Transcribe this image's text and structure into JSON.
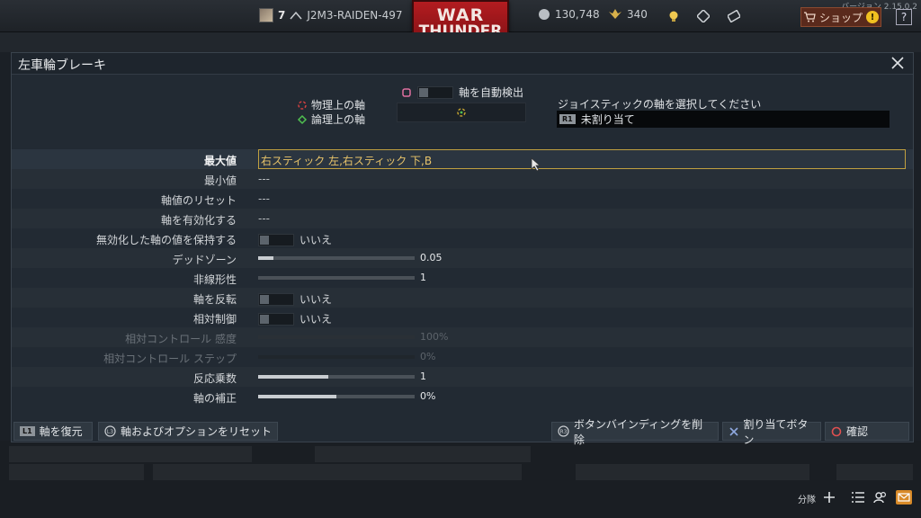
{
  "topbar": {
    "version": "バージョン 2.15.0.2",
    "rank": "7",
    "username": "J2M3-RAIDEN-497",
    "logo_line1": "WAR",
    "logo_line2": "THUNDER",
    "silver_lions": "130,748",
    "golden_eagles": "340",
    "shop_label": "ショップ",
    "help_label": "?"
  },
  "dialog": {
    "title": "左車輪ブレーキ",
    "physical_axis_label": "物理上の軸",
    "logical_axis_label": "論理上の軸",
    "auto_detect_label": "軸を自動検出",
    "joystick_prompt": "ジョイスティックの軸を選択してください",
    "joystick_button_glyph": "R1",
    "joystick_value": "未割り当て"
  },
  "rows": [
    {
      "label": "最大値",
      "value": "右スティック 左,右スティック 下,B",
      "kind": "input",
      "active": true
    },
    {
      "label": "最小値",
      "value": "---",
      "kind": "text"
    },
    {
      "label": "軸値のリセット",
      "value": "---",
      "kind": "text"
    },
    {
      "label": "軸を有効化する",
      "value": "---",
      "kind": "text"
    },
    {
      "label": "無効化した軸の値を保持する",
      "value": "いいえ",
      "kind": "toggle"
    },
    {
      "label": "デッドゾーン",
      "value": "0.05",
      "kind": "slider",
      "level": 0.1
    },
    {
      "label": "非線形性",
      "value": "1",
      "kind": "slider",
      "level": 0.0
    },
    {
      "label": "軸を反転",
      "value": "いいえ",
      "kind": "toggle"
    },
    {
      "label": "相対制御",
      "value": "いいえ",
      "kind": "toggle"
    },
    {
      "label": "相対コントロール 感度",
      "value": "100%",
      "kind": "slider",
      "level": 1.0,
      "disabled": true
    },
    {
      "label": "相対コントロール ステップ",
      "value": "0%",
      "kind": "slider",
      "level": 0.0,
      "disabled": true
    },
    {
      "label": "反応乗数",
      "value": "1",
      "kind": "slider",
      "level": 0.45
    },
    {
      "label": "軸の補正",
      "value": "0%",
      "kind": "slider",
      "level": 0.5
    }
  ],
  "footer": {
    "restore_glyph": "L1",
    "restore_label": "軸を復元",
    "reset_glyph": "L3",
    "reset_label": "軸およびオプションをリセット",
    "delete_glyph": "R3",
    "delete_label": "ボタンバインディングを削除",
    "assign_label": "割り当てボタン",
    "confirm_label": "確認"
  },
  "bottom": {
    "squad_label": "分隊"
  },
  "colors": {
    "accent_gold": "#c0a040",
    "logo_red": "#b31c20",
    "shop_warn": "#f0c020"
  }
}
